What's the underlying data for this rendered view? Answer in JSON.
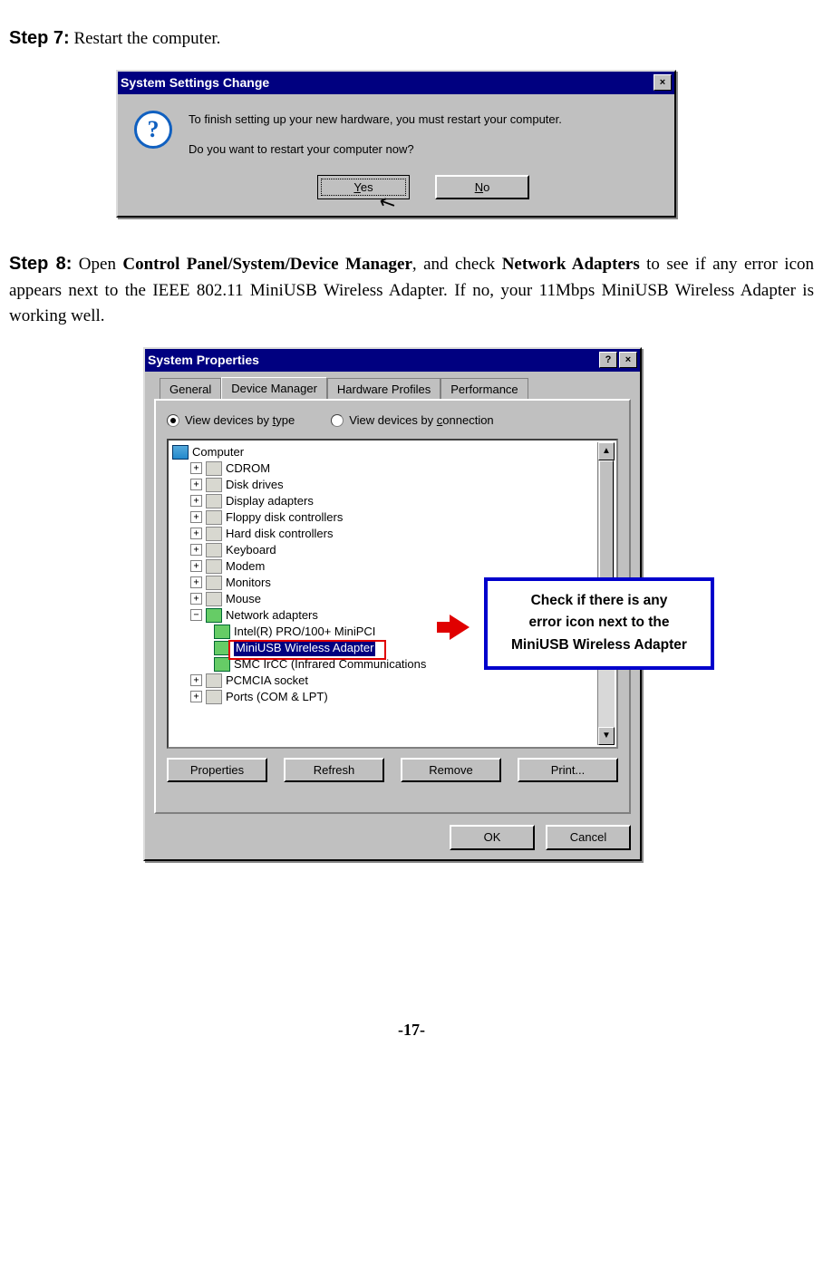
{
  "step7": {
    "label": "Step 7:",
    "text": " Restart the computer."
  },
  "dlg1": {
    "title": "System Settings Change",
    "line1": "To finish setting up your new hardware, you must restart your computer.",
    "line2": "Do you want to restart your computer now?",
    "yes_pref": "Y",
    "yes_rest": "es",
    "no_pref": "N",
    "no_rest": "o",
    "close_glyph": "×"
  },
  "step8": {
    "label": "Step 8:",
    "pre": " Open ",
    "path": "Control Panel/System/Device Manager",
    "mid": ", and check ",
    "na": "Network Adapters",
    "post": " to see if any error icon appears next to the IEEE 802.11 MiniUSB Wireless Adapter.  If no, your 11Mbps MiniUSB Wireless Adapter is working well."
  },
  "dlg2": {
    "title": "System Properties",
    "help_glyph": "?",
    "close_glyph": "×",
    "tabs": [
      "General",
      "Device Manager",
      "Hardware Profiles",
      "Performance"
    ],
    "radio_type_pref": "t",
    "radio_type": "View devices by ",
    "radio_type_suf": "ype",
    "radio_conn_pref": "c",
    "radio_conn": "View devices by ",
    "radio_conn_suf": "onnection",
    "tree": {
      "root": "Computer",
      "items": [
        "CDROM",
        "Disk drives",
        "Display adapters",
        "Floppy disk controllers",
        "Hard disk controllers",
        "Keyboard",
        "Modem",
        "Monitors",
        "Mouse"
      ],
      "net_label": "Network adapters",
      "net_children": [
        "Intel(R) PRO/100+ MiniPCI",
        "MiniUSB Wireless Adapter",
        "SMC IrCC (Infrared Communications"
      ],
      "after": [
        "PCMCIA socket",
        "Ports (COM & LPT)"
      ]
    },
    "panel_buttons": {
      "properties": "Properties",
      "refresh": "Refresh",
      "remove": "Remove",
      "print": "Print..."
    },
    "dlg_buttons": {
      "ok": "OK",
      "cancel": "Cancel"
    }
  },
  "callout": {
    "l1": "Check if there is any",
    "l2": "error icon next to the",
    "l3": "MiniUSB Wireless Adapter"
  },
  "page_num": "-17-"
}
